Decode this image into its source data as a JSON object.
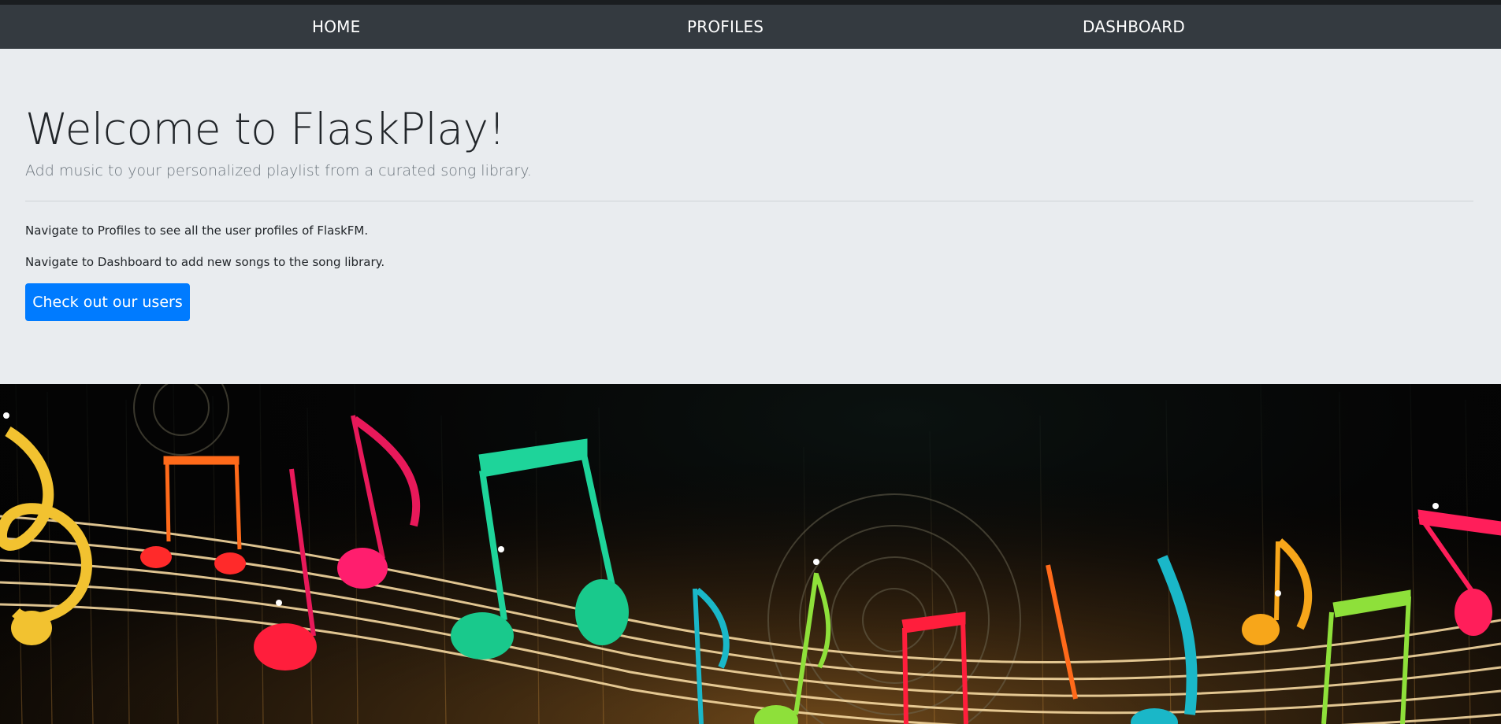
{
  "nav": {
    "items": [
      {
        "label": "HOME"
      },
      {
        "label": "PROFILES"
      },
      {
        "label": "DASHBOARD"
      }
    ]
  },
  "jumbotron": {
    "title": "Welcome to FlaskPlay!",
    "lead": "Add music to your personalized playlist from a curated song library.",
    "paragraphs": [
      "Navigate to Profiles to see all the user profiles of FlaskFM.",
      "Navigate to Dashboard to add new songs to the song library."
    ],
    "button_label": "Check out our users"
  },
  "colors": {
    "navbar": "#343a40",
    "jumbotron": "#e9ecef",
    "primary": "#007bff"
  },
  "hero": {
    "image": "music-notes-image"
  }
}
